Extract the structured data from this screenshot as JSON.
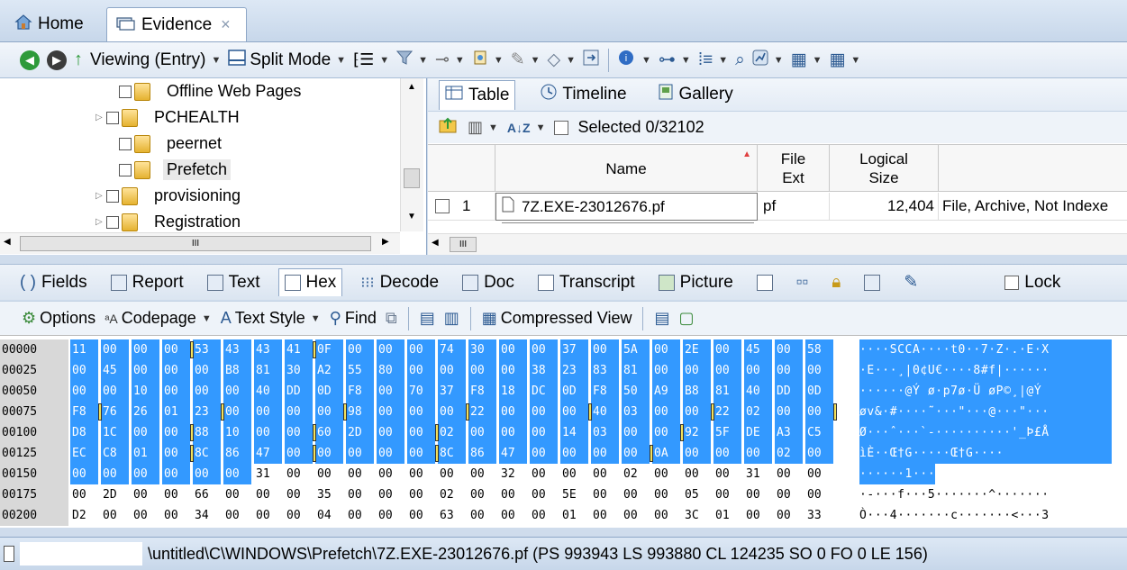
{
  "tabs": {
    "home": "Home",
    "evidence": "Evidence",
    "close": "×"
  },
  "toolbar": {
    "viewing": "Viewing (Entry)",
    "split_mode": "Split Mode"
  },
  "tree": {
    "items": [
      {
        "label": "Offline Web Pages",
        "expander": ""
      },
      {
        "label": "PCHEALTH",
        "expander": "▷"
      },
      {
        "label": "peernet",
        "expander": ""
      },
      {
        "label": "Prefetch",
        "expander": "",
        "selected": true
      },
      {
        "label": "provisioning",
        "expander": "▷"
      },
      {
        "label": "Registration",
        "expander": "▷"
      }
    ],
    "hscroll_label": "III"
  },
  "table_pane": {
    "view_tabs": [
      "Table",
      "Timeline",
      "Gallery"
    ],
    "selected_text": "Selected 0/32102",
    "columns": {
      "name": "Name",
      "file_ext": "File Ext",
      "logical_size": "Logical Size"
    },
    "row": {
      "num": "1",
      "name": "7Z.EXE-23012676.pf",
      "ext": "pf",
      "size": "12,404",
      "category": "File, Archive, Not Indexe"
    },
    "hscroll_label": "III"
  },
  "lower_tabs": {
    "fields": "Fields",
    "report": "Report",
    "text": "Text",
    "hex": "Hex",
    "decode": "Decode",
    "doc": "Doc",
    "transcript": "Transcript",
    "picture": "Picture",
    "lock": "Lock"
  },
  "hex_toolbar": {
    "options": "Options",
    "codepage": "Codepage",
    "text_style": "Text Style",
    "find": "Find",
    "compressed_view": "Compressed View"
  },
  "hex": {
    "rows": [
      {
        "offset": "00000",
        "bytes": [
          "11",
          "00",
          "00",
          "00",
          "53",
          "43",
          "43",
          "41",
          "0F",
          "00",
          "00",
          "00",
          "74",
          "30",
          "00",
          "00",
          "37",
          "00",
          "5A",
          "00",
          "2E",
          "00",
          "45",
          "00",
          "58"
        ],
        "ascii": "····SCCA····t0··7·Z·.·E·X"
      },
      {
        "offset": "00025",
        "bytes": [
          "00",
          "45",
          "00",
          "00",
          "00",
          "B8",
          "81",
          "30",
          "A2",
          "55",
          "80",
          "00",
          "00",
          "00",
          "00",
          "38",
          "23",
          "83",
          "81",
          "00",
          "00",
          "00",
          "00",
          "00",
          "00"
        ],
        "ascii": "·E···¸|0¢U€····8#f|······"
      },
      {
        "offset": "00050",
        "bytes": [
          "00",
          "00",
          "10",
          "00",
          "00",
          "00",
          "40",
          "DD",
          "0D",
          "F8",
          "00",
          "70",
          "37",
          "F8",
          "18",
          "DC",
          "0D",
          "F8",
          "50",
          "A9",
          "B8",
          "81",
          "40",
          "DD",
          "0D"
        ],
        "ascii": "······@Ý ø·p7ø·Ü øP©¸|@Ý"
      },
      {
        "offset": "00075",
        "bytes": [
          "F8",
          "76",
          "26",
          "01",
          "23",
          "00",
          "00",
          "00",
          "00",
          "98",
          "00",
          "00",
          "00",
          "22",
          "00",
          "00",
          "00",
          "40",
          "03",
          "00",
          "00",
          "22",
          "02",
          "00",
          "00"
        ],
        "ascii": "øv&·#····˜···\"···@···\"···"
      },
      {
        "offset": "00100",
        "bytes": [
          "D8",
          "1C",
          "00",
          "00",
          "88",
          "10",
          "00",
          "00",
          "60",
          "2D",
          "00",
          "00",
          "02",
          "00",
          "00",
          "00",
          "14",
          "03",
          "00",
          "00",
          "92",
          "5F",
          "DE",
          "A3",
          "C5"
        ],
        "ascii": "Ø···ˆ···`-··········'_Þ£Å"
      },
      {
        "offset": "00125",
        "bytes": [
          "EC",
          "C8",
          "01",
          "00",
          "8C",
          "86",
          "47",
          "00",
          "00",
          "00",
          "00",
          "00",
          "8C",
          "86",
          "47",
          "00",
          "00",
          "00",
          "00",
          "0A",
          "00",
          "00",
          "00",
          "02",
          "00"
        ],
        "ascii": "ìÈ··Œ†G·····Œ†G····"
      },
      {
        "offset": "00150",
        "bytes": [
          "00",
          "00",
          "00",
          "00",
          "00",
          "00",
          "31",
          "00",
          "00",
          "00",
          "00",
          "00",
          "00",
          "00",
          "32",
          "00",
          "00",
          "00",
          "02",
          "00",
          "00",
          "00",
          "31",
          "00",
          "00"
        ],
        "ascii": "······1·······2·······1··"
      },
      {
        "offset": "00175",
        "bytes": [
          "00",
          "2D",
          "00",
          "00",
          "66",
          "00",
          "00",
          "00",
          "35",
          "00",
          "00",
          "00",
          "02",
          "00",
          "00",
          "00",
          "5E",
          "00",
          "00",
          "00",
          "05",
          "00",
          "00",
          "00",
          "00"
        ],
        "ascii": "·-···f···5·······^·······"
      },
      {
        "offset": "00200",
        "bytes": [
          "D2",
          "00",
          "00",
          "00",
          "34",
          "00",
          "00",
          "00",
          "04",
          "00",
          "00",
          "00",
          "63",
          "00",
          "00",
          "00",
          "01",
          "00",
          "00",
          "00",
          "3C",
          "01",
          "00",
          "00",
          "33"
        ],
        "ascii": "Ò···4·······c·······<···3"
      }
    ]
  },
  "status": {
    "path": "\\untitled\\C\\WINDOWS\\Prefetch\\7Z.EXE-23012676.pf (PS 993943 LS 993880 CL 124235 SO 0 FO 0 LE 156)"
  },
  "colors": {
    "selection": "#3399ff",
    "marker": "#f3e15a",
    "chrome": "#cfdcec"
  }
}
